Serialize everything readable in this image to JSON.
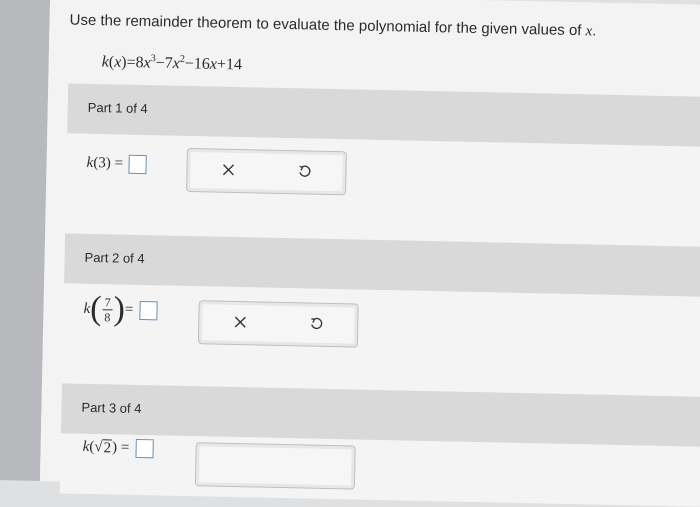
{
  "question": {
    "prefix": "Use the remainder theorem to evaluate the polynomial for the given values of ",
    "variable": "x",
    "suffix": "."
  },
  "polynomial": {
    "lhs_func": "k",
    "lhs_var": "x",
    "term1_coef": "8",
    "term1_exp": "3",
    "term2_coef": "7",
    "term2_exp": "2",
    "term3": "16",
    "constant": "14"
  },
  "parts": [
    {
      "header": "Part 1 of 4",
      "func": "k",
      "arg": "3",
      "equals": "="
    },
    {
      "header": "Part 2 of 4",
      "func": "k",
      "num": "7",
      "den": "8",
      "equals": "="
    },
    {
      "header": "Part 3 of 4",
      "func": "k",
      "radical": "2",
      "equals": "="
    }
  ],
  "tools": {
    "clear_symbol": "×",
    "undo_symbol": "↺"
  },
  "icons": {
    "clear": "x-icon",
    "undo": "undo-icon"
  },
  "colors": {
    "answer_box_border": "#6a8fb6",
    "header_bg": "#d9d9da"
  }
}
